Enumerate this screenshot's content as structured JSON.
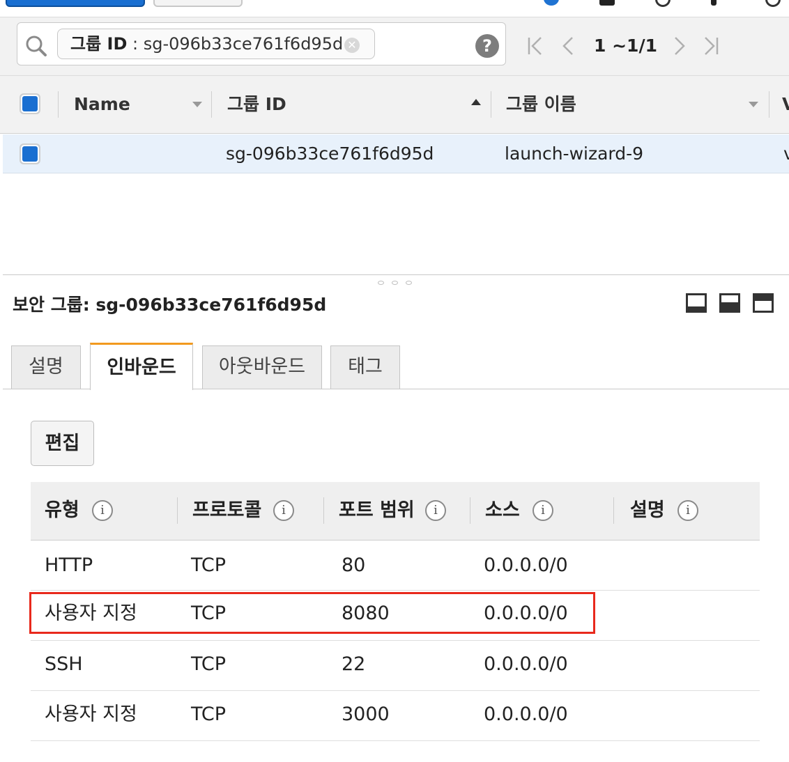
{
  "search": {
    "filter_key": "그룹 ID",
    "filter_sep": " : ",
    "filter_value": "sg-096b33ce761f6d95d",
    "help": "?",
    "clear": "✕"
  },
  "pager": {
    "first": "|<",
    "prev": "<",
    "range": "1 ~1/1",
    "next": ">",
    "last": ">|"
  },
  "list_table": {
    "columns": [
      "Name",
      "그룹 ID",
      "그룹 이름",
      "V"
    ],
    "rows": [
      {
        "name": "",
        "group_id": "sg-096b33ce761f6d95d",
        "group_name": "launch-wizard-9",
        "vpc": "v"
      }
    ]
  },
  "detail": {
    "title": "보안 그룹: sg-096b33ce761f6d95d",
    "tabs": [
      "설명",
      "인바운드",
      "아웃바운드",
      "태그"
    ],
    "active_tab": "인바운드",
    "edit_label": "편집",
    "rules_columns": [
      "유형",
      "프로토콜",
      "포트 범위",
      "소스",
      "설명"
    ],
    "rules": [
      {
        "type": "HTTP",
        "protocol": "TCP",
        "port": "80",
        "source": "0.0.0.0/0",
        "desc": ""
      },
      {
        "type": "사용자 지정",
        "protocol": "TCP",
        "port": "8080",
        "source": "0.0.0.0/0",
        "desc": ""
      },
      {
        "type": "SSH",
        "protocol": "TCP",
        "port": "22",
        "source": "0.0.0.0/0",
        "desc": ""
      },
      {
        "type": "사용자 지정",
        "protocol": "TCP",
        "port": "3000",
        "source": "0.0.0.0/0",
        "desc": ""
      }
    ],
    "highlighted_rule_index": 1
  },
  "colors": {
    "accent_blue": "#1a6fd1",
    "active_tab_orange": "#f29a1f",
    "highlight_red": "#e8291c",
    "selected_row": "#e8f1fb"
  },
  "icons": [
    "search-icon",
    "clear-icon",
    "help-icon",
    "first-page-icon",
    "prev-page-icon",
    "next-page-icon",
    "last-page-icon",
    "info-icon",
    "layout-bottom-icon",
    "layout-split-icon",
    "layout-top-icon"
  ]
}
